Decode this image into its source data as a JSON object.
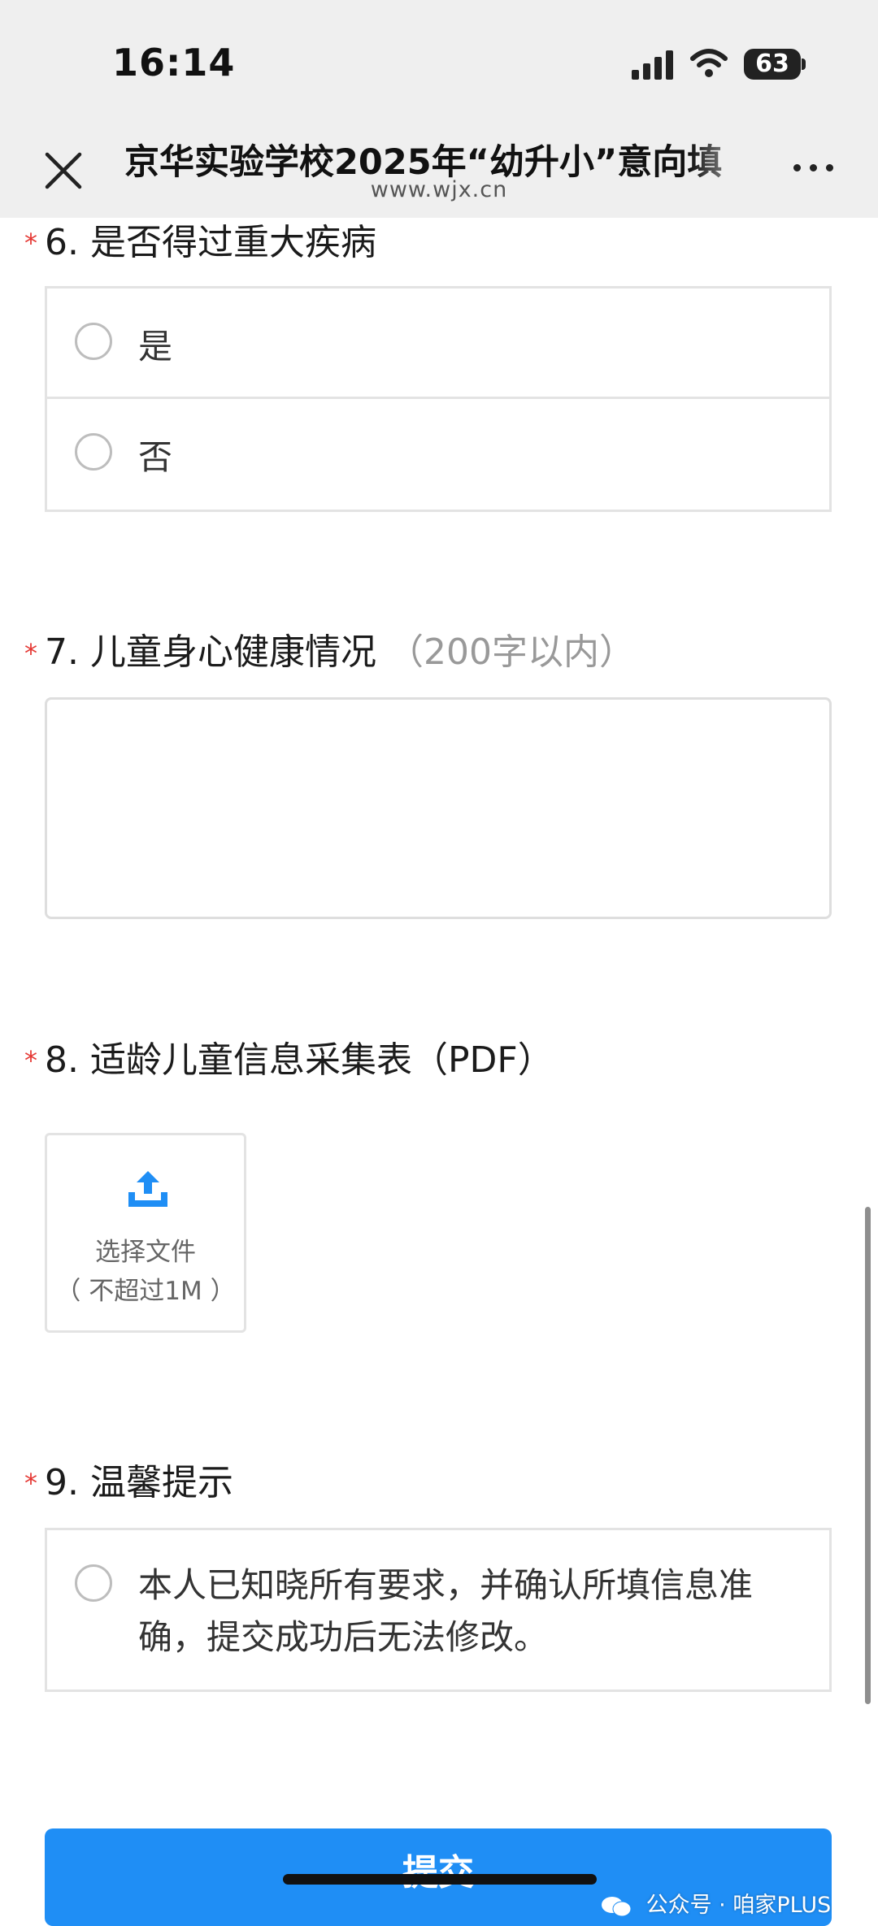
{
  "status_bar": {
    "time": "16:14",
    "battery": "63"
  },
  "header": {
    "title": "京华实验学校2025年“幼升小”意向填",
    "domain": "www.wjx.cn"
  },
  "questions": {
    "q6": {
      "required_mark": "*",
      "title": "6. 是否得过重大疾病",
      "options": [
        "是",
        "否"
      ]
    },
    "q7": {
      "required_mark": "*",
      "title": "7. 儿童身心健康情况",
      "hint": "（200字以内）",
      "value": ""
    },
    "q8": {
      "required_mark": "*",
      "title": "8. 适龄儿童信息采集表（PDF）",
      "upload_label": "选择文件",
      "upload_note": "（ 不超过1M ）"
    },
    "q9": {
      "required_mark": "*",
      "title": "9. 温馨提示",
      "option": "本人已知晓所有要求，并确认所填信息准确，提交成功后无法修改。"
    }
  },
  "submit_label": "提交",
  "watermark": "公众号 · 咱家PLUS",
  "colors": {
    "accent": "#1f8ef5",
    "required": "#e53935",
    "border": "#e3e3e3"
  },
  "icons": [
    "signal-icon",
    "wifi-icon",
    "close-icon",
    "more-icon",
    "upload-icon",
    "wechat-icon"
  ]
}
